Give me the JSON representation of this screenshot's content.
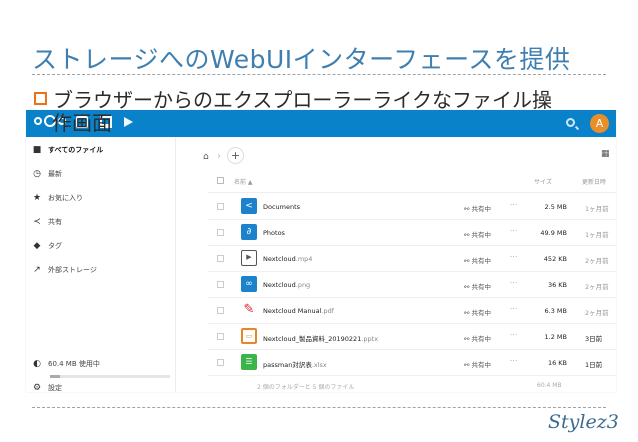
{
  "slide": {
    "title": "ストレージへのWebUIインターフェースを提供",
    "bullet_line1": "ブラウザーからのエクスプローラーライクなファイル操",
    "bullet_line2": "作画面",
    "brand": "Stylez3",
    "accent": "#e8731a",
    "title_color": "#3f7fb0"
  },
  "app": {
    "topbar_color": "#0a82c9",
    "logo_icon": "nextcloud-logo-icon",
    "header_icons": [
      "files-app-icon",
      "activity-app-icon",
      "gallery-app-icon"
    ],
    "avatar_initial": "A"
  },
  "sidebar": {
    "items": [
      {
        "label": "すべてのファイル",
        "icon": "folder-icon"
      },
      {
        "label": "最新",
        "icon": "clock-icon"
      },
      {
        "label": "お気に入り",
        "icon": "star-icon"
      },
      {
        "label": "共有",
        "icon": "share-icon"
      },
      {
        "label": "タグ",
        "icon": "tag-icon"
      },
      {
        "label": "外部ストレージ",
        "icon": "external-storage-icon"
      }
    ],
    "quota": "60.4 MB 使用中",
    "settings": "設定"
  },
  "files": {
    "header": {
      "name": "名前 ▲",
      "size": "サイズ",
      "modified": "更新日時"
    },
    "rows": [
      {
        "name": "Documents",
        "ext": "",
        "type": "folder",
        "share": "共有中",
        "size": "2.5 MB",
        "modified": "1ヶ月前",
        "recent": false
      },
      {
        "name": "Photos",
        "ext": "",
        "type": "folder-shared",
        "share": "共有中",
        "size": "49.9 MB",
        "modified": "1ヶ月前",
        "recent": false
      },
      {
        "name": "Nextcloud",
        "ext": ".mp4",
        "type": "video",
        "share": "共有中",
        "size": "452 KB",
        "modified": "2ヶ月前",
        "recent": false
      },
      {
        "name": "Nextcloud",
        "ext": ".png",
        "type": "image",
        "share": "共有中",
        "size": "36 KB",
        "modified": "2ヶ月前",
        "recent": false
      },
      {
        "name": "Nextcloud Manual",
        "ext": ".pdf",
        "type": "pdf",
        "share": "共有中",
        "size": "6.3 MB",
        "modified": "2ヶ月前",
        "recent": false
      },
      {
        "name": "Nextcloud_製品資料_20190221",
        "ext": ".pptx",
        "type": "pptx",
        "share": "共有中",
        "size": "1.2 MB",
        "modified": "3日前",
        "recent": true
      },
      {
        "name": "passman対訳表",
        "ext": ".xlsx",
        "type": "xlsx",
        "share": "共有中",
        "size": "16 KB",
        "modified": "1日前",
        "recent": true
      }
    ],
    "summary": "2 個のフォルダーと 5 個のファイル",
    "summary_size": "60.4 MB"
  }
}
